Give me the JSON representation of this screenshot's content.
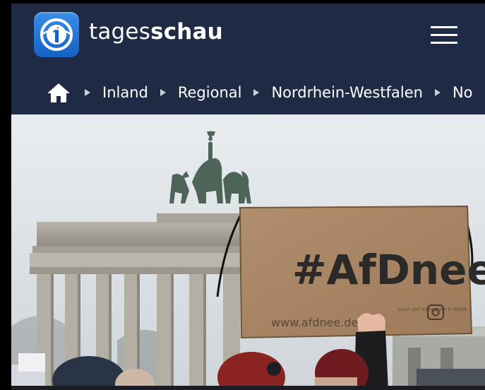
{
  "header": {
    "brand_regular": "tages",
    "brand_bold": "schau",
    "logo_icon": "ard-one-logo-icon",
    "menu_icon": "hamburger-menu-icon"
  },
  "breadcrumb": {
    "home_icon": "home-icon",
    "items": [
      {
        "label": "Inland"
      },
      {
        "label": "Regional"
      },
      {
        "label": "Nordrhein-Westfalen"
      },
      {
        "label": "No"
      }
    ]
  },
  "hero": {
    "sign_text": "#AfDnee",
    "sign_url": "www.afdnee.de",
    "sign_note": "auch auf instagram & tiktok"
  },
  "colors": {
    "header_bg": "#1f2b45",
    "logo_blue": "#1f74d6",
    "text": "#ffffff"
  }
}
